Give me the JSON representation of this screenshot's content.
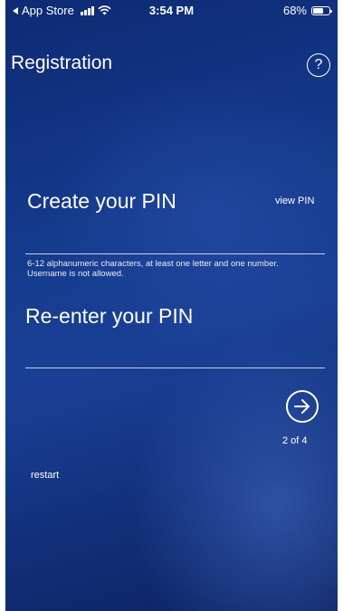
{
  "status_bar": {
    "back_app": "App Store",
    "time": "3:54 PM",
    "battery_percent": "68%",
    "battery_level": 0.68
  },
  "header": {
    "title": "Registration",
    "help_symbol": "?"
  },
  "form": {
    "create_pin_label": "Create your PIN",
    "view_pin_label": "view PIN",
    "create_pin_value": "",
    "pin_hint": "6-12 alphanumeric characters, at least one letter and one number. Username is not allowed.",
    "reenter_pin_label": "Re-enter your PIN",
    "reenter_pin_value": ""
  },
  "navigation": {
    "next_icon": "arrow-right-circle-icon",
    "step_text": "2 of 4",
    "restart_label": "restart"
  }
}
